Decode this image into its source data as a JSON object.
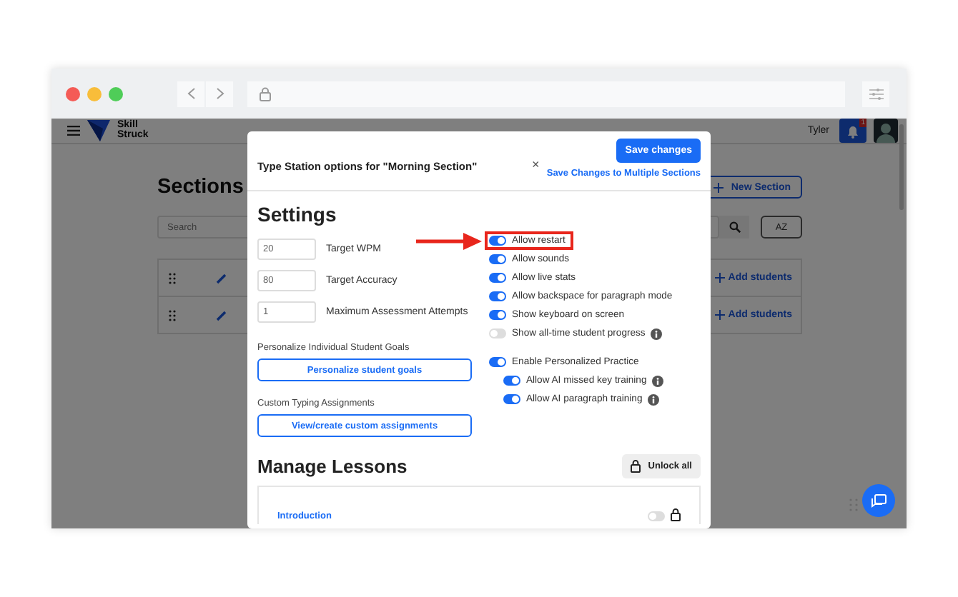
{
  "app": {
    "brand": "Skill Struck",
    "user": "Tyler",
    "notification_count": "1",
    "page_title": "Sections",
    "search_placeholder": "Search",
    "new_section": "New Section",
    "sort": "AZ",
    "rows": [
      {
        "action": "Add students"
      },
      {
        "action": "Add students"
      }
    ]
  },
  "modal": {
    "title": "Type Station options for \"Morning Section\"",
    "close": "×",
    "save": "Save changes",
    "save_multiple": "Save Changes to Multiple Sections",
    "settings_heading": "Settings",
    "fields": [
      {
        "value": "20",
        "label": "Target WPM"
      },
      {
        "value": "80",
        "label": "Target Accuracy"
      },
      {
        "value": "1",
        "label": "Maximum Assessment Attempts"
      }
    ],
    "goals_label": "Personalize Individual Student Goals",
    "goals_button": "Personalize student goals",
    "custom_label": "Custom Typing Assignments",
    "custom_button": "View/create custom assignments",
    "toggles": [
      {
        "label": "Allow restart",
        "on": true,
        "info": false,
        "highlighted": true
      },
      {
        "label": "Allow sounds",
        "on": true,
        "info": false,
        "highlighted": false
      },
      {
        "label": "Allow live stats",
        "on": true,
        "info": false,
        "highlighted": false
      },
      {
        "label": "Allow backspace for paragraph mode",
        "on": true,
        "info": false,
        "highlighted": false
      },
      {
        "label": "Show keyboard on screen",
        "on": true,
        "info": false,
        "highlighted": false
      },
      {
        "label": "Show all-time student progress",
        "on": false,
        "info": true,
        "highlighted": false
      },
      {
        "label": "Enable Personalized Practice",
        "on": true,
        "info": false,
        "highlighted": false,
        "children": [
          {
            "label": "Allow AI missed key training",
            "on": true,
            "info": true,
            "highlighted": false
          },
          {
            "label": "Allow AI paragraph training",
            "on": true,
            "info": true,
            "highlighted": false
          }
        ]
      }
    ],
    "lessons_heading": "Manage Lessons",
    "unlock_all": "Unlock all",
    "lessons": [
      {
        "name": "Introduction",
        "on": false,
        "locked": true
      }
    ]
  }
}
